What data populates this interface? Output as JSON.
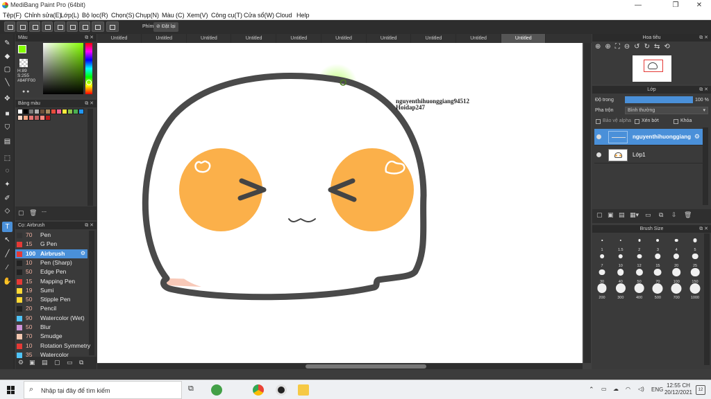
{
  "window": {
    "title": "MediBang Paint Pro (64bit)",
    "controls": [
      "—",
      "❐",
      "✕"
    ]
  },
  "menu": [
    "Tệp(F)",
    "Chỉnh sửa(E)",
    "Lớp(L)",
    "Bộ lọc(R)",
    "Chọn(S)",
    "Chụp(N)",
    "Màu (C)",
    "Xem(V)",
    "Công cụ(T)",
    "Cửa sổ(W)",
    "Cloud",
    "Help"
  ],
  "toolbar": {
    "phim_label": "Phím",
    "reset_label": "Đặt lại"
  },
  "tabs": [
    "Untitled",
    "Untitled",
    "Untitled",
    "Untitled",
    "Untitled",
    "Untitled",
    "Untitled",
    "Untitled",
    "Untitled",
    "Untitled"
  ],
  "color_panel": {
    "title": "Màu",
    "h": "H:89",
    "s": "S:255",
    "hex": "#84FF00",
    "current_color": "#84ff00"
  },
  "palette_panel": {
    "title": "Bảng màu",
    "swatches": [
      "#ffffff",
      "#000000",
      "#7a7a7a",
      "#b0b0b0",
      "#6b4f3a",
      "#a88b5e",
      "#e74c3c",
      "#f06292",
      "#ffeb3b",
      "#8bc34a",
      "#4caf50",
      "#2196f3",
      "#f8d7c6",
      "#f4a582",
      "#e57373",
      "#c06060",
      "#ff8a80",
      "#b71c1c"
    ],
    "footer_text": "---"
  },
  "brush_panel": {
    "title": "Cọ: Airbrush",
    "items": [
      {
        "size": "70",
        "name": "Pen",
        "color": "#333333"
      },
      {
        "size": "15",
        "name": "G Pen",
        "color": "#e53935"
      },
      {
        "size": "100",
        "name": "Airbrush",
        "color": "#e53935"
      },
      {
        "size": "10",
        "name": "Pen (Sharp)",
        "color": "#222222"
      },
      {
        "size": "50",
        "name": "Edge Pen",
        "color": "#222222"
      },
      {
        "size": "15",
        "name": "Mapping Pen",
        "color": "#e53935"
      },
      {
        "size": "19",
        "name": "Sumi",
        "color": "#fdd835"
      },
      {
        "size": "50",
        "name": "Stipple Pen",
        "color": "#fdd835"
      },
      {
        "size": "20",
        "name": "Pencil",
        "color": "#222222"
      },
      {
        "size": "90",
        "name": "Watercolor (Wet)",
        "color": "#4fc3f7"
      },
      {
        "size": "50",
        "name": "Blur",
        "color": "#ce93d8"
      },
      {
        "size": "70",
        "name": "Smudge",
        "color": "#f4c7b0"
      },
      {
        "size": "10",
        "name": "Rotation Symmetry",
        "color": "#e53935"
      },
      {
        "size": "35",
        "name": "Watercolor",
        "color": "#4fc3f7"
      }
    ]
  },
  "canvas": {
    "watermark_line1": "nguyenthihuonggiang94512",
    "watermark_line2": "Hoidap247"
  },
  "navigator_panel": {
    "title": "Hoa tiêu"
  },
  "layer_panel": {
    "title": "Lớp",
    "opacity_label": "Độ trong",
    "opacity_value": "100 %",
    "opacity": 1.0,
    "blend_label": "Pha trộn",
    "blend_value": "Bình thường",
    "protect_alpha": "Bảo vệ alpha",
    "clipping": "Xén bớt",
    "lock": "Khóa",
    "layers": [
      {
        "name": "nguyenthihuonggiang",
        "active": true
      },
      {
        "name": "Lớp1",
        "active": false
      }
    ]
  },
  "brush_size_panel": {
    "title": "Brush Size",
    "sizes": [
      "1",
      "1.5",
      "2",
      "3",
      "4",
      "5",
      "7",
      "10",
      "12",
      "15",
      "20",
      "25",
      "30",
      "40",
      "50",
      "70",
      "100",
      "150",
      "200",
      "300",
      "400",
      "500",
      "700",
      "1000"
    ]
  },
  "taskbar": {
    "search_placeholder": "Nhập tại đây để tìm kiếm",
    "lang": "ENG",
    "time": "12:55 CH",
    "date": "20/12/2021",
    "notification_count": "12"
  }
}
